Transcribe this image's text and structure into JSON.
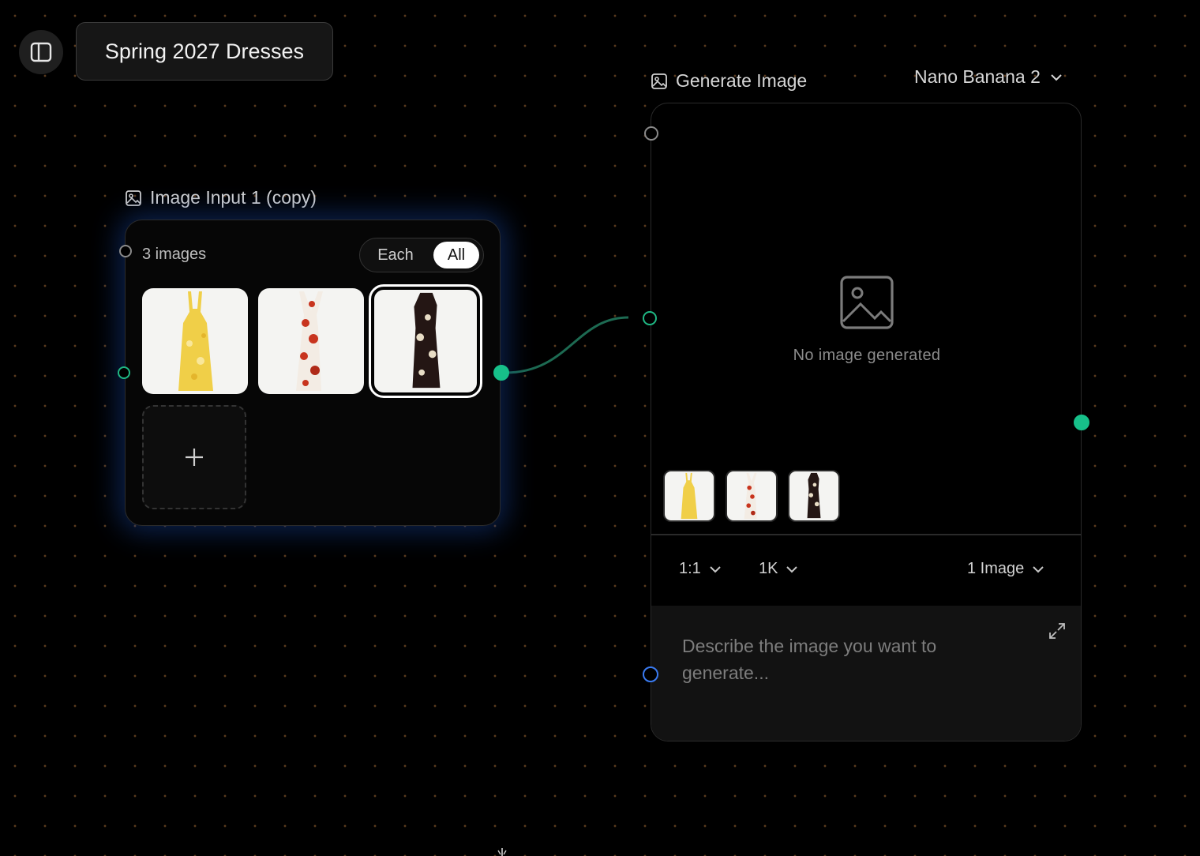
{
  "project": {
    "title": "Spring 2027 Dresses"
  },
  "input_node": {
    "label": "Image Input 1 (copy)",
    "count_text": "3 images",
    "mode_each": "Each",
    "mode_all": "All",
    "selected_mode": "All",
    "images": [
      {
        "name": "yellow floral dress",
        "color": "#f2d24f"
      },
      {
        "name": "red floral dress",
        "color": "#c8341e"
      },
      {
        "name": "black floral dress",
        "color": "#2a1a16",
        "selected": true
      }
    ],
    "add_label": "+"
  },
  "generate_node": {
    "label": "Generate Image",
    "model": "Nano Banana 2",
    "empty_text": "No image generated",
    "aspect_ratio": "1:1",
    "resolution": "1K",
    "image_count": "1 Image",
    "prompt_placeholder": "Describe the image you want to generate..."
  },
  "colors": {
    "port_green": "#17c08a",
    "port_blue": "#3a7bf2",
    "edge": "#1d6a52",
    "glow": "#143c8c"
  }
}
